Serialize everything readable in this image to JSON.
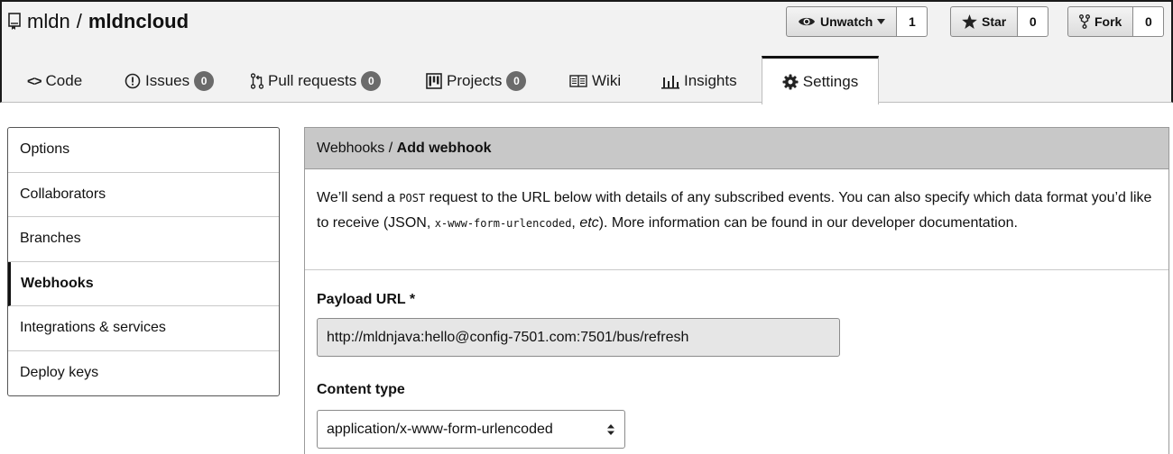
{
  "repo": {
    "owner": "mldn",
    "separator": "/",
    "name": "mldncloud"
  },
  "social": {
    "watch": {
      "label": "Unwatch",
      "count": "1"
    },
    "star": {
      "label": "Star",
      "count": "0"
    },
    "fork": {
      "label": "Fork",
      "count": "0"
    }
  },
  "tabs": [
    {
      "label": "Code"
    },
    {
      "label": "Issues",
      "badge": "0"
    },
    {
      "label": "Pull requests",
      "badge": "0"
    },
    {
      "label": "Projects",
      "badge": "0"
    },
    {
      "label": "Wiki"
    },
    {
      "label": "Insights"
    },
    {
      "label": "Settings",
      "selected": true
    }
  ],
  "sidebar": {
    "items": [
      {
        "label": "Options"
      },
      {
        "label": "Collaborators"
      },
      {
        "label": "Branches"
      },
      {
        "label": "Webhooks",
        "selected": true
      },
      {
        "label": "Integrations & services"
      },
      {
        "label": "Deploy keys"
      }
    ]
  },
  "panel": {
    "crumb_parent": "Webhooks /",
    "crumb_current": "Add webhook",
    "desc": {
      "t1": "We’ll send a ",
      "code1": "POST",
      "t2": " request to the URL below with details of any subscribed events. You can also specify which data format you’d like to receive (JSON, ",
      "code2": "x-www-form-urlencoded",
      "t3": ", ",
      "em": "etc",
      "t4": "). More information can be found in our developer documentation."
    },
    "payload_label": "Payload URL *",
    "payload_value": "http://mldnjava:hello@config-7501.com:7501/bus/refresh",
    "content_label": "Content type",
    "content_value": "application/x-www-form-urlencoded"
  },
  "colors": {
    "badge": "#6b6b6b",
    "header_bg": "#f2f2f2",
    "panel_head_bg": "#c8c8c8"
  }
}
